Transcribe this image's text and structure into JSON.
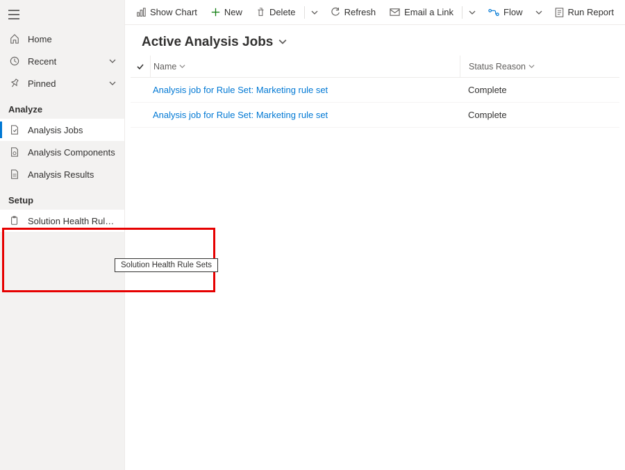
{
  "sidebar": {
    "home": "Home",
    "recent": "Recent",
    "pinned": "Pinned",
    "section_analyze": "Analyze",
    "analysis_jobs": "Analysis Jobs",
    "analysis_components": "Analysis Components",
    "analysis_results": "Analysis Results",
    "section_setup": "Setup",
    "solution_health": "Solution Health Rule ...",
    "solution_health_tooltip": "Solution Health Rule Sets"
  },
  "commands": {
    "show_chart": "Show Chart",
    "new": "New",
    "delete": "Delete",
    "refresh": "Refresh",
    "email_link": "Email a Link",
    "flow": "Flow",
    "run_report": "Run Report"
  },
  "view": {
    "title": "Active Analysis Jobs"
  },
  "grid": {
    "col_name": "Name",
    "col_status": "Status Reason",
    "rows": [
      {
        "name": "Analysis job for Rule Set: Marketing rule set",
        "status": "Complete"
      },
      {
        "name": "Analysis job for Rule Set: Marketing rule set",
        "status": "Complete"
      }
    ]
  }
}
